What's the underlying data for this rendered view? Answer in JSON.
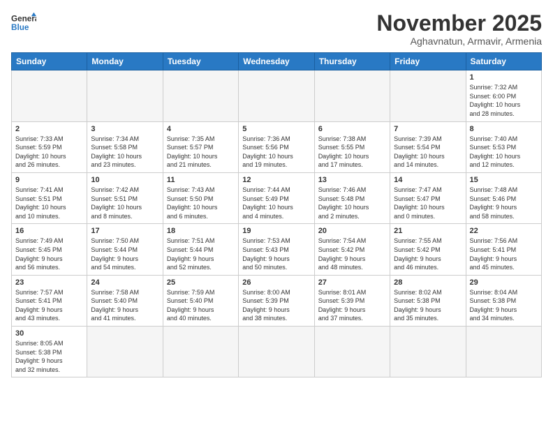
{
  "header": {
    "logo_general": "General",
    "logo_blue": "Blue",
    "month_year": "November 2025",
    "location": "Aghavnatun, Armavir, Armenia"
  },
  "days_of_week": [
    "Sunday",
    "Monday",
    "Tuesday",
    "Wednesday",
    "Thursday",
    "Friday",
    "Saturday"
  ],
  "weeks": [
    [
      {
        "day": "",
        "info": "",
        "empty": true
      },
      {
        "day": "",
        "info": "",
        "empty": true
      },
      {
        "day": "",
        "info": "",
        "empty": true
      },
      {
        "day": "",
        "info": "",
        "empty": true
      },
      {
        "day": "",
        "info": "",
        "empty": true
      },
      {
        "day": "",
        "info": "",
        "empty": true
      },
      {
        "day": "1",
        "info": "Sunrise: 7:32 AM\nSunset: 6:00 PM\nDaylight: 10 hours\nand 28 minutes."
      }
    ],
    [
      {
        "day": "2",
        "info": "Sunrise: 7:33 AM\nSunset: 5:59 PM\nDaylight: 10 hours\nand 26 minutes."
      },
      {
        "day": "3",
        "info": "Sunrise: 7:34 AM\nSunset: 5:58 PM\nDaylight: 10 hours\nand 23 minutes."
      },
      {
        "day": "4",
        "info": "Sunrise: 7:35 AM\nSunset: 5:57 PM\nDaylight: 10 hours\nand 21 minutes."
      },
      {
        "day": "5",
        "info": "Sunrise: 7:36 AM\nSunset: 5:56 PM\nDaylight: 10 hours\nand 19 minutes."
      },
      {
        "day": "6",
        "info": "Sunrise: 7:38 AM\nSunset: 5:55 PM\nDaylight: 10 hours\nand 17 minutes."
      },
      {
        "day": "7",
        "info": "Sunrise: 7:39 AM\nSunset: 5:54 PM\nDaylight: 10 hours\nand 14 minutes."
      },
      {
        "day": "8",
        "info": "Sunrise: 7:40 AM\nSunset: 5:53 PM\nDaylight: 10 hours\nand 12 minutes."
      }
    ],
    [
      {
        "day": "9",
        "info": "Sunrise: 7:41 AM\nSunset: 5:51 PM\nDaylight: 10 hours\nand 10 minutes."
      },
      {
        "day": "10",
        "info": "Sunrise: 7:42 AM\nSunset: 5:51 PM\nDaylight: 10 hours\nand 8 minutes."
      },
      {
        "day": "11",
        "info": "Sunrise: 7:43 AM\nSunset: 5:50 PM\nDaylight: 10 hours\nand 6 minutes."
      },
      {
        "day": "12",
        "info": "Sunrise: 7:44 AM\nSunset: 5:49 PM\nDaylight: 10 hours\nand 4 minutes."
      },
      {
        "day": "13",
        "info": "Sunrise: 7:46 AM\nSunset: 5:48 PM\nDaylight: 10 hours\nand 2 minutes."
      },
      {
        "day": "14",
        "info": "Sunrise: 7:47 AM\nSunset: 5:47 PM\nDaylight: 10 hours\nand 0 minutes."
      },
      {
        "day": "15",
        "info": "Sunrise: 7:48 AM\nSunset: 5:46 PM\nDaylight: 9 hours\nand 58 minutes."
      }
    ],
    [
      {
        "day": "16",
        "info": "Sunrise: 7:49 AM\nSunset: 5:45 PM\nDaylight: 9 hours\nand 56 minutes."
      },
      {
        "day": "17",
        "info": "Sunrise: 7:50 AM\nSunset: 5:44 PM\nDaylight: 9 hours\nand 54 minutes."
      },
      {
        "day": "18",
        "info": "Sunrise: 7:51 AM\nSunset: 5:44 PM\nDaylight: 9 hours\nand 52 minutes."
      },
      {
        "day": "19",
        "info": "Sunrise: 7:53 AM\nSunset: 5:43 PM\nDaylight: 9 hours\nand 50 minutes."
      },
      {
        "day": "20",
        "info": "Sunrise: 7:54 AM\nSunset: 5:42 PM\nDaylight: 9 hours\nand 48 minutes."
      },
      {
        "day": "21",
        "info": "Sunrise: 7:55 AM\nSunset: 5:42 PM\nDaylight: 9 hours\nand 46 minutes."
      },
      {
        "day": "22",
        "info": "Sunrise: 7:56 AM\nSunset: 5:41 PM\nDaylight: 9 hours\nand 45 minutes."
      }
    ],
    [
      {
        "day": "23",
        "info": "Sunrise: 7:57 AM\nSunset: 5:41 PM\nDaylight: 9 hours\nand 43 minutes."
      },
      {
        "day": "24",
        "info": "Sunrise: 7:58 AM\nSunset: 5:40 PM\nDaylight: 9 hours\nand 41 minutes."
      },
      {
        "day": "25",
        "info": "Sunrise: 7:59 AM\nSunset: 5:40 PM\nDaylight: 9 hours\nand 40 minutes."
      },
      {
        "day": "26",
        "info": "Sunrise: 8:00 AM\nSunset: 5:39 PM\nDaylight: 9 hours\nand 38 minutes."
      },
      {
        "day": "27",
        "info": "Sunrise: 8:01 AM\nSunset: 5:39 PM\nDaylight: 9 hours\nand 37 minutes."
      },
      {
        "day": "28",
        "info": "Sunrise: 8:02 AM\nSunset: 5:38 PM\nDaylight: 9 hours\nand 35 minutes."
      },
      {
        "day": "29",
        "info": "Sunrise: 8:04 AM\nSunset: 5:38 PM\nDaylight: 9 hours\nand 34 minutes."
      }
    ],
    [
      {
        "day": "30",
        "info": "Sunrise: 8:05 AM\nSunset: 5:38 PM\nDaylight: 9 hours\nand 32 minutes."
      },
      {
        "day": "",
        "info": "",
        "empty": true
      },
      {
        "day": "",
        "info": "",
        "empty": true
      },
      {
        "day": "",
        "info": "",
        "empty": true
      },
      {
        "day": "",
        "info": "",
        "empty": true
      },
      {
        "day": "",
        "info": "",
        "empty": true
      },
      {
        "day": "",
        "info": "",
        "empty": true
      }
    ]
  ]
}
